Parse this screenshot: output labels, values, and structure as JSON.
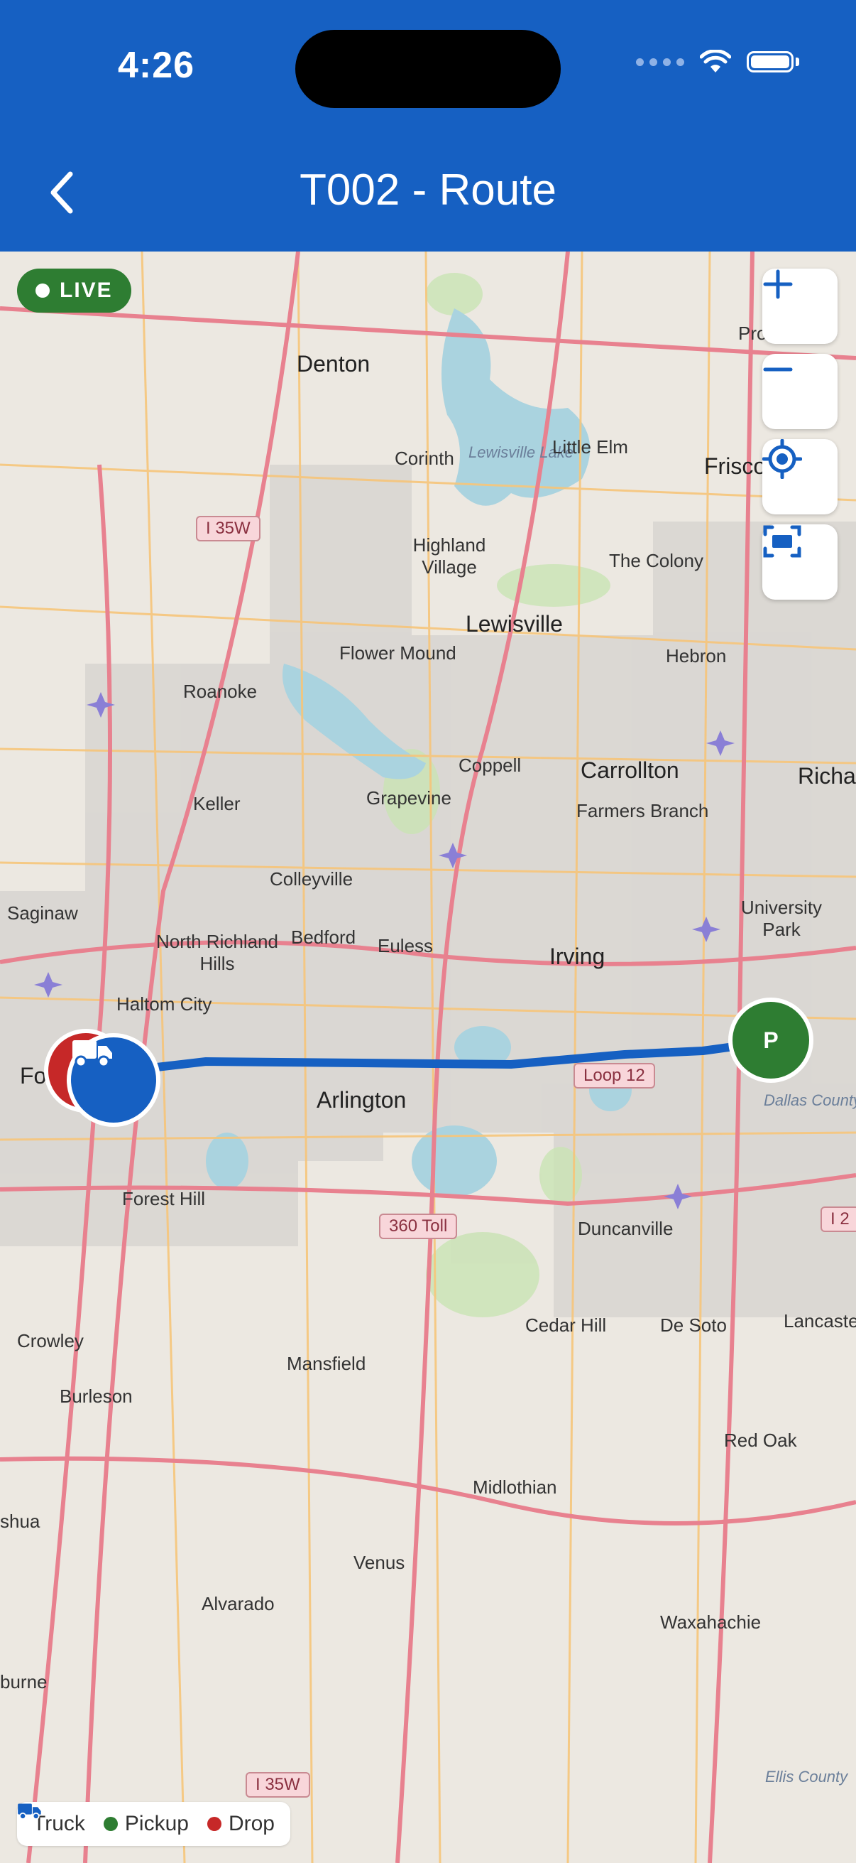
{
  "status_bar": {
    "time": "4:26"
  },
  "header": {
    "title": "T002 - Route"
  },
  "map": {
    "live_label": "LIVE",
    "places": {
      "denton": "Denton",
      "corinth": "Corinth",
      "lewisville_lake": "Lewisville Lake",
      "little_elm": "Little Elm",
      "frisco": "Frisco",
      "prosper": "Prosper",
      "highland_village": "Highland Village",
      "the_colony": "The Colony",
      "lewisville": "Lewisville",
      "flower_mound": "Flower Mound",
      "hebron": "Hebron",
      "roanoke": "Roanoke",
      "coppell": "Coppell",
      "carrollton": "Carrollton",
      "richardson": "Richa",
      "grapevine": "Grapevine",
      "farmers_branch": "Farmers Branch",
      "keller": "Keller",
      "colleyville": "Colleyville",
      "university_park": "University Park",
      "saginaw": "Saginaw",
      "north_richland_hills": "North Richland Hills",
      "bedford": "Bedford",
      "euless": "Euless",
      "irving": "Irving",
      "haltom_city": "Haltom City",
      "fort_worth": "Fo",
      "arlington": "Arlington",
      "dallas_county": "Dallas County",
      "forest_hill": "Forest Hill",
      "duncanville": "Duncanville",
      "crowley": "Crowley",
      "cedar_hill": "Cedar Hill",
      "de_soto": "De Soto",
      "lancaster": "Lancaste",
      "mansfield": "Mansfield",
      "burleson": "Burleson",
      "red_oak": "Red Oak",
      "midlothian": "Midlothian",
      "joshua": "shua",
      "venus": "Venus",
      "alvarado": "Alvarado",
      "waxahachie": "Waxahachie",
      "cleburne": "burne",
      "ellis_county": "Ellis County"
    },
    "shields": {
      "i35w_north": "I 35W",
      "loop12": "Loop 12",
      "toll360": "360 Toll",
      "i20": "I 2",
      "i35w_south": "I 35W"
    },
    "pickup_marker": "P",
    "route_color": "#1660c2"
  },
  "legend": {
    "truck": "Truck",
    "pickup": "Pickup",
    "drop": "Drop"
  },
  "colors": {
    "header": "#1660c2",
    "live": "#2e7d32",
    "pickup": "#2e7d32",
    "drop": "#c62828",
    "truck": "#1660c2"
  }
}
